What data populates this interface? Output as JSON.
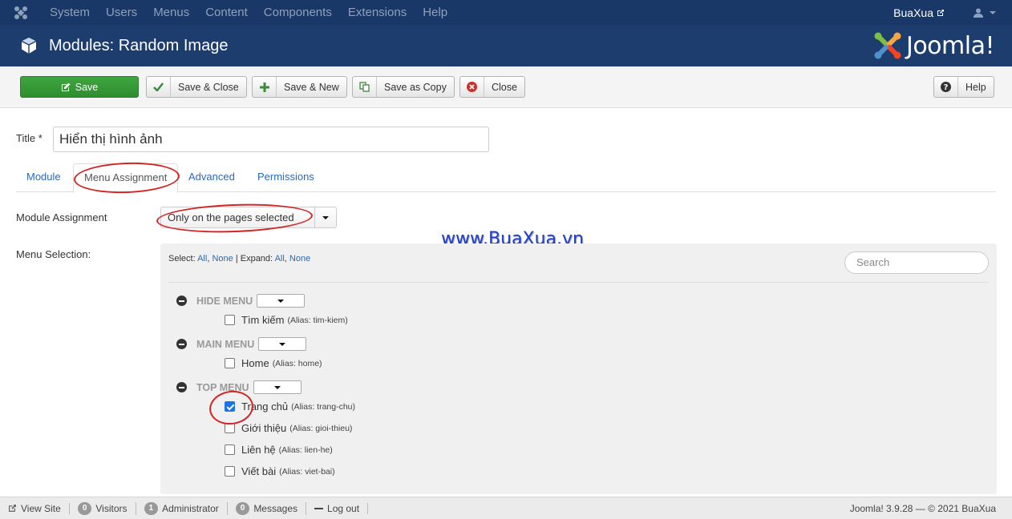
{
  "nav": {
    "items": [
      "System",
      "Users",
      "Menus",
      "Content",
      "Components",
      "Extensions",
      "Help"
    ],
    "user": "BuaXua"
  },
  "header": {
    "title": "Modules: Random Image",
    "brand": "Joomla!"
  },
  "toolbar": {
    "save": "Save",
    "save_close": "Save & Close",
    "save_new": "Save & New",
    "save_copy": "Save as Copy",
    "close": "Close",
    "help": "Help"
  },
  "form": {
    "title_label": "Title *",
    "title_value": "Hiển thị hình ảnh"
  },
  "tabs": [
    "Module",
    "Menu Assignment",
    "Advanced",
    "Permissions"
  ],
  "assignment": {
    "label": "Module Assignment",
    "selected": "Only on the pages selected"
  },
  "watermark": "www.BuaXua.vn",
  "menu_selection": {
    "label": "Menu Selection:",
    "select_label": "Select:",
    "all": "All",
    "none": "None",
    "sep": "|",
    "expand_label": "Expand:",
    "search_placeholder": "Search",
    "groups": [
      {
        "name": "HIDE MENU",
        "items": [
          {
            "title": "Tìm kiếm",
            "alias": "(Alias: tim-kiem)",
            "checked": false
          }
        ]
      },
      {
        "name": "MAIN MENU",
        "items": [
          {
            "title": "Home",
            "alias": "(Alias: home)",
            "checked": false
          }
        ]
      },
      {
        "name": "TOP MENU",
        "items": [
          {
            "title": "Trang chủ",
            "alias": "(Alias: trang-chu)",
            "checked": true
          },
          {
            "title": "Giới thiệu",
            "alias": "(Alias: gioi-thieu)",
            "checked": false
          },
          {
            "title": "Liên hệ",
            "alias": "(Alias: lien-he)",
            "checked": false
          },
          {
            "title": "Viết bài",
            "alias": "(Alias: viet-bai)",
            "checked": false
          }
        ]
      }
    ]
  },
  "footer": {
    "view_site": "View Site",
    "visitors_count": "0",
    "visitors": "Visitors",
    "admin_count": "1",
    "admin": "Administrator",
    "messages_count": "0",
    "messages": "Messages",
    "logout": "Log out",
    "version": "Joomla! 3.9.28 — © 2021 BuaXua"
  },
  "colors": {
    "navbar": "#1a3867",
    "header": "#1c3d6e",
    "save": "#3fa63f",
    "link": "#2a69b8",
    "annotation": "#d42424"
  }
}
